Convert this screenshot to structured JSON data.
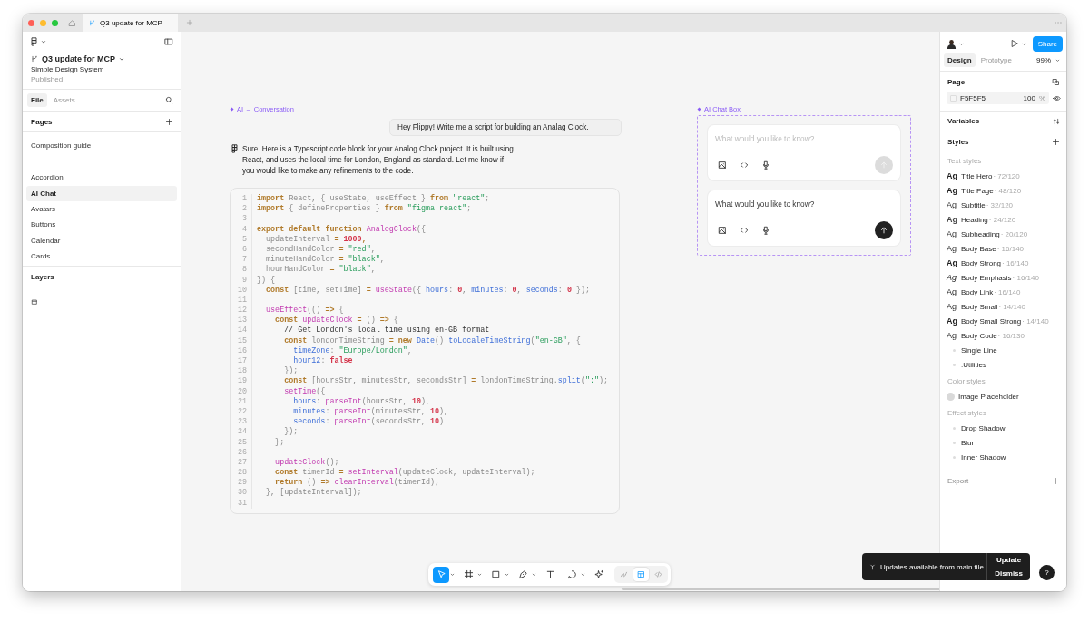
{
  "browser": {
    "tabs": [
      {
        "label": "Q3 update for MCP",
        "selected": true
      }
    ]
  },
  "left_panel": {
    "file_name": "Q3 update for MCP",
    "team": "Simple Design System",
    "status": "Published",
    "tabs": [
      {
        "label": "File",
        "selected": true
      },
      {
        "label": "Assets",
        "selected": false
      }
    ],
    "pages_title": "Pages",
    "pages": [
      {
        "label": "Composition guide",
        "selected": false,
        "kind": "top"
      },
      {
        "label": "Accordion",
        "selected": false,
        "kind": "page"
      },
      {
        "label": "AI Chat",
        "selected": true,
        "kind": "page"
      },
      {
        "label": "Avatars",
        "selected": false,
        "kind": "page"
      },
      {
        "label": "Buttons",
        "selected": false,
        "kind": "page"
      },
      {
        "label": "Calendar",
        "selected": false,
        "kind": "page"
      },
      {
        "label": "Cards",
        "selected": false,
        "kind": "page"
      }
    ],
    "layers_title": "Layers"
  },
  "canvas": {
    "conversation": {
      "label": "AI → Conversation",
      "user_message": "Hey Flippy! Write me a script for building an Analag Clock.",
      "reply": "Sure. Here is a Typescript code block for your Analog Clock project. It is built using React, and uses the local time for London, England as standard. Let me know if you would like to make any refinements to the code.",
      "code": [
        {
          "number": "1",
          "tokens": [
            {
              "kind": "kw",
              "text": "import"
            },
            {
              "kind": "p",
              "text": " React, { useState, useEffect } "
            },
            {
              "kind": "kw",
              "text": "from"
            },
            {
              "kind": "str",
              "text": " \"react\""
            },
            {
              "kind": "p",
              "text": ";"
            }
          ]
        },
        {
          "number": "2",
          "tokens": [
            {
              "kind": "kw",
              "text": "import"
            },
            {
              "kind": "p",
              "text": " { defineProperties } "
            },
            {
              "kind": "kw",
              "text": "from"
            },
            {
              "kind": "str",
              "text": " \"figma:react\""
            },
            {
              "kind": "p",
              "text": ";"
            }
          ]
        },
        {
          "number": "3"
        },
        {
          "number": "4",
          "tokens": [
            {
              "kind": "kw",
              "text": "export default function"
            },
            {
              "kind": "fn",
              "text": " AnalogClock"
            },
            {
              "kind": "p",
              "text": "({"
            }
          ]
        },
        {
          "number": "5",
          "tokens": [
            {
              "kind": "p",
              "text": "  updateInterval "
            },
            {
              "kind": "kw",
              "text": "="
            },
            {
              "kind": "num",
              "text": " 1000"
            },
            {
              "kind": "kw",
              "text": ","
            }
          ]
        },
        {
          "number": "6",
          "tokens": [
            {
              "kind": "p",
              "text": "  secondHandColor "
            },
            {
              "kind": "kw",
              "text": "="
            },
            {
              "kind": "str",
              "text": " \"red\""
            },
            {
              "kind": "p",
              "text": ","
            }
          ]
        },
        {
          "number": "7",
          "tokens": [
            {
              "kind": "p",
              "text": "  minuteHandColor "
            },
            {
              "kind": "kw",
              "text": "="
            },
            {
              "kind": "str",
              "text": " \"black\""
            },
            {
              "kind": "p",
              "text": ","
            }
          ]
        },
        {
          "number": "8",
          "tokens": [
            {
              "kind": "p",
              "text": "  hourHandColor "
            },
            {
              "kind": "kw",
              "text": "="
            },
            {
              "kind": "str",
              "text": " \"black\""
            },
            {
              "kind": "p",
              "text": ","
            }
          ]
        },
        {
          "number": "9",
          "tokens": [
            {
              "kind": "p",
              "text": "}) {"
            }
          ]
        },
        {
          "number": "10",
          "tokens": [
            {
              "kind": "kw",
              "text": "  const"
            },
            {
              "kind": "p",
              "text": " [time, setTime] "
            },
            {
              "kind": "kw",
              "text": "="
            },
            {
              "kind": "fn",
              "text": " useState"
            },
            {
              "kind": "p",
              "text": "({ "
            },
            {
              "kind": "prop",
              "text": "hours"
            },
            {
              "kind": "p",
              "text": ": "
            },
            {
              "kind": "num",
              "text": "0"
            },
            {
              "kind": "p",
              "text": ", "
            },
            {
              "kind": "prop",
              "text": "minutes"
            },
            {
              "kind": "p",
              "text": ": "
            },
            {
              "kind": "num",
              "text": "0"
            },
            {
              "kind": "p",
              "text": ", "
            },
            {
              "kind": "prop",
              "text": "seconds"
            },
            {
              "kind": "p",
              "text": ": "
            },
            {
              "kind": "num",
              "text": "0"
            },
            {
              "kind": "p",
              "text": " });"
            }
          ]
        },
        {
          "number": "11"
        },
        {
          "number": "12",
          "tokens": [
            {
              "kind": "fn",
              "text": "  useEffect"
            },
            {
              "kind": "p",
              "text": "(() "
            },
            {
              "kind": "kw",
              "text": "=>"
            },
            {
              "kind": "p",
              "text": " {"
            }
          ]
        },
        {
          "number": "13",
          "tokens": [
            {
              "kind": "kw",
              "text": "    const"
            },
            {
              "kind": "fn",
              "text": " updateClock"
            },
            {
              "kind": "kw",
              "text": " ="
            },
            {
              "kind": "p",
              "text": " () "
            },
            {
              "kind": "kw",
              "text": "=>"
            },
            {
              "kind": "p",
              "text": " {"
            }
          ]
        },
        {
          "number": "14",
          "tokens": [
            {
              "kind": "comment",
              "text": "      // Get London's local time using en-GB format"
            }
          ]
        },
        {
          "number": "15",
          "tokens": [
            {
              "kind": "kw",
              "text": "      const"
            },
            {
              "kind": "p",
              "text": " londonTimeString "
            },
            {
              "kind": "kw",
              "text": "= new"
            },
            {
              "kind": "prop",
              "text": " Date"
            },
            {
              "kind": "p",
              "text": "()."
            },
            {
              "kind": "prop",
              "text": "toLocaleTimeString"
            },
            {
              "kind": "p",
              "text": "("
            },
            {
              "kind": "str",
              "text": "\"en-GB\""
            },
            {
              "kind": "p",
              "text": ", {"
            }
          ]
        },
        {
          "number": "16",
          "tokens": [
            {
              "kind": "prop",
              "text": "        timeZone"
            },
            {
              "kind": "p",
              "text": ": "
            },
            {
              "kind": "str",
              "text": "\"Europe/London\""
            },
            {
              "kind": "p",
              "text": ","
            }
          ]
        },
        {
          "number": "17",
          "tokens": [
            {
              "kind": "prop",
              "text": "        hour12"
            },
            {
              "kind": "p",
              "text": ": "
            },
            {
              "kind": "num",
              "text": "false"
            }
          ]
        },
        {
          "number": "18",
          "tokens": [
            {
              "kind": "p",
              "text": "      });"
            }
          ]
        },
        {
          "number": "19",
          "tokens": [
            {
              "kind": "kw",
              "text": "      const"
            },
            {
              "kind": "p",
              "text": " [hoursStr, minutesStr, secondsStr] "
            },
            {
              "kind": "kw",
              "text": "="
            },
            {
              "kind": "p",
              "text": " londonTimeString."
            },
            {
              "kind": "prop",
              "text": "split"
            },
            {
              "kind": "p",
              "text": "("
            },
            {
              "kind": "str",
              "text": "\":\""
            },
            {
              "kind": "p",
              "text": ");"
            }
          ]
        },
        {
          "number": "20",
          "tokens": [
            {
              "kind": "fn",
              "text": "      setTime"
            },
            {
              "kind": "p",
              "text": "({"
            }
          ]
        },
        {
          "number": "21",
          "tokens": [
            {
              "kind": "prop",
              "text": "        hours"
            },
            {
              "kind": "p",
              "text": ": "
            },
            {
              "kind": "fn",
              "text": "parseInt"
            },
            {
              "kind": "p",
              "text": "(hoursStr, "
            },
            {
              "kind": "num",
              "text": "10"
            },
            {
              "kind": "p",
              "text": "),"
            }
          ]
        },
        {
          "number": "22",
          "tokens": [
            {
              "kind": "prop",
              "text": "        minutes"
            },
            {
              "kind": "p",
              "text": ": "
            },
            {
              "kind": "fn",
              "text": "parseInt"
            },
            {
              "kind": "p",
              "text": "(minutesStr, "
            },
            {
              "kind": "num",
              "text": "10"
            },
            {
              "kind": "p",
              "text": "),"
            }
          ]
        },
        {
          "number": "23",
          "tokens": [
            {
              "kind": "prop",
              "text": "        seconds"
            },
            {
              "kind": "p",
              "text": ": "
            },
            {
              "kind": "fn",
              "text": "parseInt"
            },
            {
              "kind": "p",
              "text": "(secondsStr, "
            },
            {
              "kind": "num",
              "text": "10"
            },
            {
              "kind": "p",
              "text": ")"
            }
          ]
        },
        {
          "number": "24",
          "tokens": [
            {
              "kind": "p",
              "text": "      });"
            }
          ]
        },
        {
          "number": "25",
          "tokens": [
            {
              "kind": "p",
              "text": "    };"
            }
          ]
        },
        {
          "number": "26"
        },
        {
          "number": "27",
          "tokens": [
            {
              "kind": "fn",
              "text": "    updateClock"
            },
            {
              "kind": "p",
              "text": "();"
            }
          ]
        },
        {
          "number": "28",
          "tokens": [
            {
              "kind": "kw",
              "text": "    const"
            },
            {
              "kind": "p",
              "text": " timerId "
            },
            {
              "kind": "kw",
              "text": "="
            },
            {
              "kind": "fn",
              "text": " setInterval"
            },
            {
              "kind": "p",
              "text": "(updateClock, updateInterval);"
            }
          ]
        },
        {
          "number": "29",
          "tokens": [
            {
              "kind": "kw",
              "text": "    return"
            },
            {
              "kind": "p",
              "text": " () "
            },
            {
              "kind": "kw",
              "text": "=>"
            },
            {
              "kind": "fn",
              "text": " clearInterval"
            },
            {
              "kind": "p",
              "text": "(timerId);"
            }
          ]
        },
        {
          "number": "30",
          "tokens": [
            {
              "kind": "p",
              "text": "  }, [updateInterval]);"
            }
          ]
        },
        {
          "number": "31"
        }
      ]
    },
    "chat_box": {
      "label": "AI Chat Box",
      "inputs": [
        {
          "placeholder": "What would you like to know?",
          "send_disabled": true
        },
        {
          "value": "What would you like to know?",
          "send_disabled": false
        }
      ]
    },
    "toolbar": {
      "tools": [
        {
          "kind": "move",
          "selected": true,
          "menu": true
        },
        {
          "kind": "frame",
          "selected": false,
          "menu": true
        },
        {
          "kind": "rect",
          "selected": false,
          "menu": true
        },
        {
          "kind": "pen",
          "selected": false,
          "menu": true
        },
        {
          "kind": "text",
          "selected": false,
          "menu": false
        },
        {
          "kind": "comment",
          "selected": false,
          "menu": true
        },
        {
          "kind": "ai",
          "selected": false,
          "menu": false
        }
      ],
      "modes": [
        {
          "kind": "draw",
          "selected": false
        },
        {
          "kind": "design",
          "selected": true
        },
        {
          "kind": "dev",
          "selected": false
        }
      ]
    },
    "toast": {
      "message": "Updates available from main file",
      "actions": [
        "Update",
        "Dismiss"
      ]
    },
    "help": "?"
  },
  "right_panel": {
    "share": "Share",
    "tabs": [
      {
        "label": "Design",
        "selected": true
      },
      {
        "label": "Prototype",
        "selected": false
      }
    ],
    "zoom": "99%",
    "page": {
      "title": "Page",
      "fill": "F5F5F5",
      "opacity": "100",
      "unit": "%"
    },
    "variables": "Variables",
    "styles_title": "Styles",
    "text_styles_title": "Text styles",
    "text_styles": [
      {
        "sample": "Ag",
        "kind": "bold",
        "name": "Title Hero",
        "spec": "· 72/120"
      },
      {
        "sample": "Ag",
        "kind": "bold",
        "name": "Title Page",
        "spec": "· 48/120"
      },
      {
        "sample": "Ag",
        "kind": "regular",
        "name": "Subtitle",
        "spec": "· 32/120"
      },
      {
        "sample": "Ag",
        "kind": "semibold",
        "name": "Heading",
        "spec": "· 24/120"
      },
      {
        "sample": "Ag",
        "kind": "regular",
        "name": "Subheading",
        "spec": "· 20/120"
      },
      {
        "sample": "Ag",
        "kind": "regular",
        "name": "Body Base",
        "spec": "· 16/140"
      },
      {
        "sample": "Ag",
        "kind": "bold",
        "name": "Body Strong",
        "spec": "· 16/140"
      },
      {
        "sample": "Ag",
        "kind": "italic",
        "name": "Body Emphasis",
        "spec": "· 16/140"
      },
      {
        "sample": "Ag",
        "kind": "link",
        "name": "Body Link",
        "spec": "· 16/140"
      },
      {
        "sample": "Ag",
        "kind": "regular",
        "name": "Body Small",
        "spec": "· 14/140"
      },
      {
        "sample": "Ag",
        "kind": "bold",
        "name": "Body Small Strong",
        "spec": "· 14/140"
      },
      {
        "sample": "Ag",
        "kind": "regular",
        "name": "Body Code",
        "spec": "· 16/130"
      }
    ],
    "text_style_groups": [
      "Single Line",
      ".Utilities"
    ],
    "color_styles_title": "Color styles",
    "color_styles": [
      {
        "name": "Image Placeholder",
        "color": "#d9d9d9"
      }
    ],
    "effect_styles_title": "Effect styles",
    "effect_styles": [
      "Drop Shadow",
      "Blur",
      "Inner Shadow"
    ],
    "export": "Export"
  }
}
